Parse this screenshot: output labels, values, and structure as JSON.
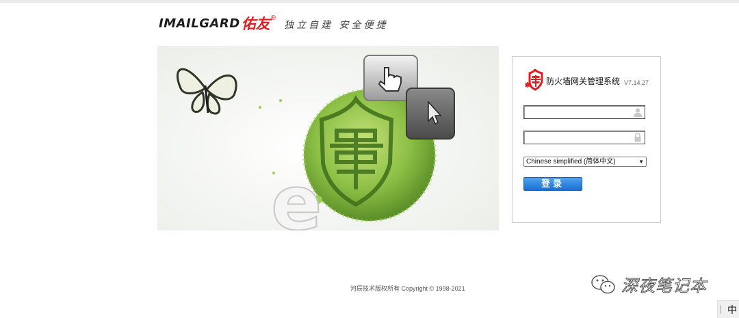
{
  "brand": {
    "wordmark": "IMAILGARD",
    "cn_name": "佑友",
    "reg_mark": "®",
    "slogan": "独立自建 安全便捷"
  },
  "login": {
    "title": "防火墙网关管理系统",
    "version": "V7.14.27",
    "username": {
      "value": "",
      "placeholder": ""
    },
    "password": {
      "value": "",
      "placeholder": ""
    },
    "language": {
      "selected": "Chinese simplified (简体中文)"
    },
    "submit_label": "登录"
  },
  "footer": {
    "copyright": "河辰技术版权所有 Copyright © 1998-2021"
  },
  "watermark": {
    "text": "深夜笔记本"
  },
  "taskbar": {
    "ime_label": "中"
  },
  "icons": {
    "user": "user-icon",
    "lock": "lock-icon",
    "shield": "shield-logo-icon",
    "wechat": "wechat-icon"
  },
  "colors": {
    "brand_red": "#e01c24",
    "button_blue": "#1b6fd2",
    "hero_green": "#7fb53b"
  }
}
